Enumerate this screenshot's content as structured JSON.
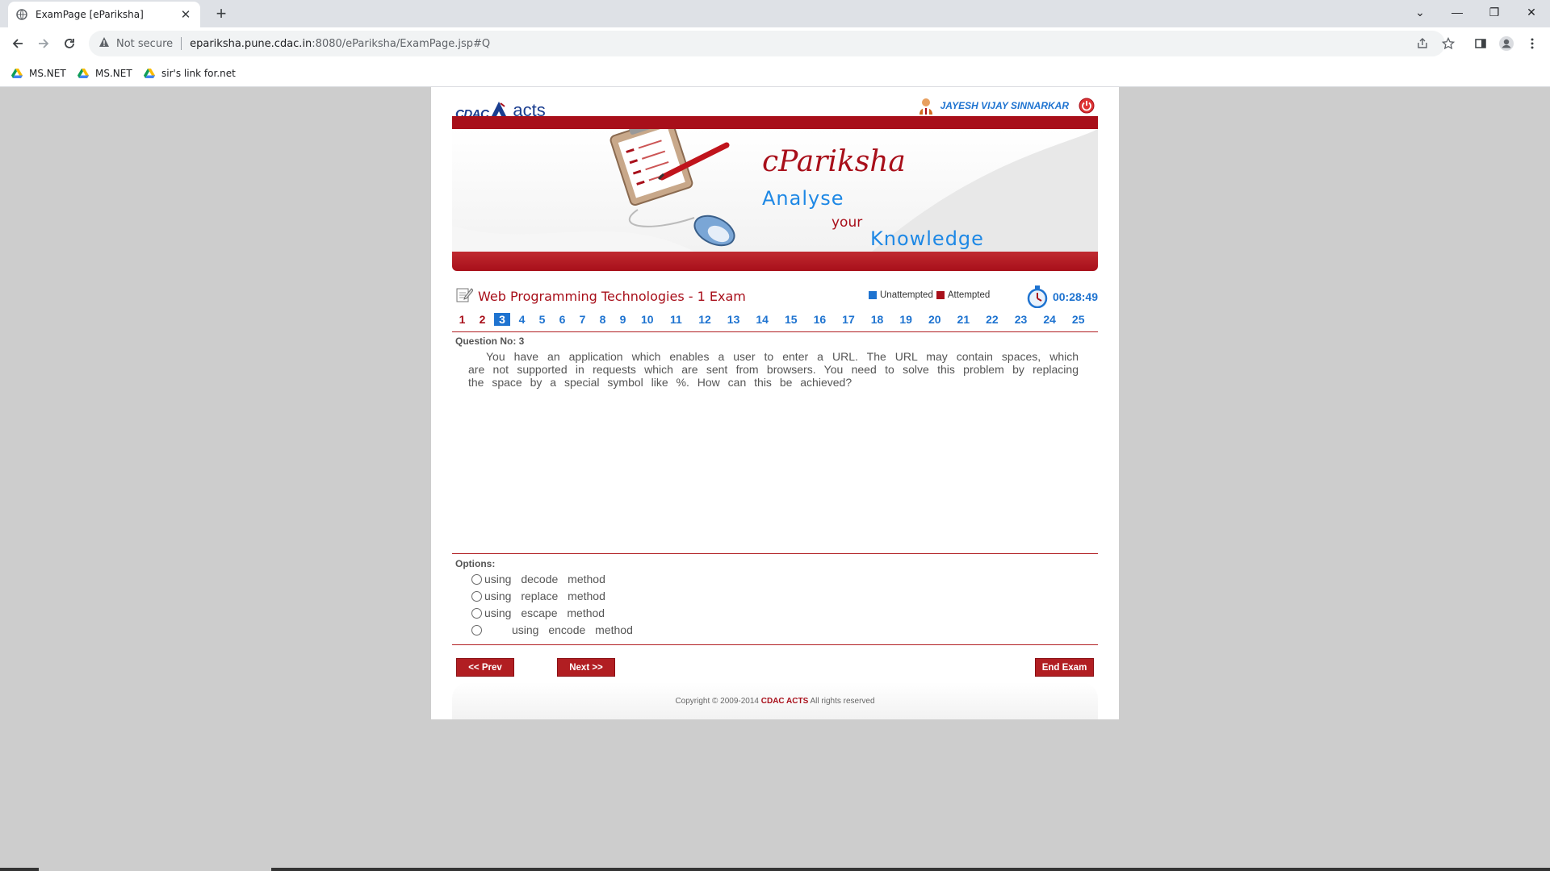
{
  "browser": {
    "tab_title": "ExamPage [ePariksha]",
    "new_tab": "+",
    "security": "Not secure",
    "url_host": "epariksha.pune.cdac.in",
    "url_path": ":8080/ePariksha/ExamPage.jsp#Q",
    "bookmarks": [
      "MS.NET",
      "MS.NET",
      "sir's link for.net"
    ]
  },
  "header": {
    "logo_cdac": "CDAC",
    "logo_acts": "acts",
    "user_name": "JAYESH VIJAY SINNARKAR"
  },
  "banner": {
    "brand": "cPariksha",
    "line1": "Analyse",
    "line2": "your",
    "line3": "Knowledge"
  },
  "exam": {
    "title": "Web Programming Technologies - 1 Exam",
    "legend_unattempted": "Unattempted",
    "legend_attempted": "Attempted",
    "timer": "00:28:49",
    "colors": {
      "unattempted": "#1e73d0",
      "attempted": "#a80f1a"
    }
  },
  "questions": {
    "numbers": [
      "1",
      "2",
      "3",
      "4",
      "5",
      "6",
      "7",
      "8",
      "9",
      "10",
      "11",
      "12",
      "13",
      "14",
      "15",
      "16",
      "17",
      "18",
      "19",
      "20",
      "21",
      "22",
      "23",
      "24",
      "25"
    ],
    "attempted": [
      1,
      2
    ],
    "current": 3
  },
  "question": {
    "label": "Question No: 3",
    "text": "You have an application which enables a user to enter a URL. The URL may contain spaces, which are not supported in requests which are sent from browsers.  You need to solve this problem by replacing the space by a special symbol like %.  How can this be achieved?"
  },
  "options": {
    "label": "Options:",
    "items": [
      "using decode method",
      "using replace method",
      "using escape method",
      "using encode method"
    ]
  },
  "buttons": {
    "prev": "<< Prev",
    "next": "Next >>",
    "end": "End Exam"
  },
  "footer": {
    "copyright": "Copyright © 2009-2014",
    "org": "CDAC ACTS",
    "rights": "All rights reserved"
  }
}
